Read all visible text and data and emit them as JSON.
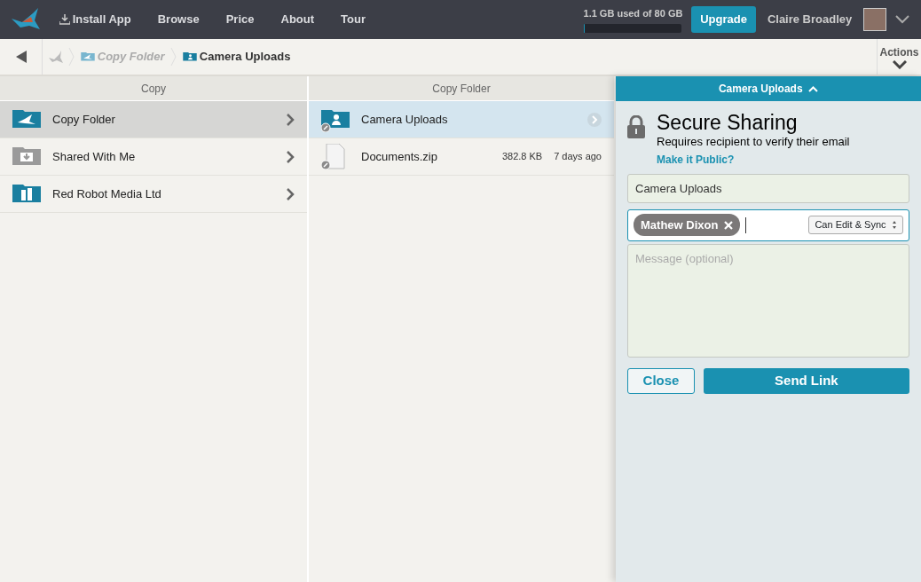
{
  "topbar": {
    "nav": [
      {
        "label": "Install App",
        "kind": "install"
      },
      {
        "label": "Browse",
        "kind": "plain"
      },
      {
        "label": "Price",
        "kind": "plain"
      },
      {
        "label": "About",
        "kind": "plain"
      },
      {
        "label": "Tour",
        "kind": "plain"
      }
    ],
    "storage": {
      "text": "1.1 GB used of 80 GB",
      "level": 0.014
    },
    "upgrade": "Upgrade",
    "user": "Claire Broadley"
  },
  "breadcrumb": {
    "items": [
      {
        "label": "Copy Folder",
        "kind": "crane",
        "selected": false
      },
      {
        "label": "Camera Uploads",
        "kind": "shared",
        "selected": true
      }
    ],
    "actions": "Actions"
  },
  "columns": [
    {
      "header": "Copy",
      "items": [
        {
          "name": "Copy Folder",
          "kind": "crane",
          "selected": true
        },
        {
          "name": "Shared With Me",
          "kind": "inbox",
          "selected": false
        },
        {
          "name": "Red Robot Media Ltd",
          "kind": "building",
          "selected": false
        }
      ]
    },
    {
      "header": "Copy Folder",
      "items": [
        {
          "name": "Camera Uploads",
          "kind": "shared",
          "selected": true,
          "linked": true
        },
        {
          "name": "Documents.zip",
          "kind": "zip",
          "selected": false,
          "linked": true,
          "size": "382.8 KB",
          "modified": "7 days ago"
        }
      ]
    }
  ],
  "share": {
    "title": "Camera Uploads",
    "heading": "Secure Sharing",
    "subtitle": "Requires recipient to verify their email",
    "public_link": "Make it Public?",
    "name_value": "Camera Uploads",
    "recipients": [
      {
        "name": "Mathew Dixon"
      }
    ],
    "permission": "Can Edit & Sync",
    "message_placeholder": "Message (optional)",
    "close": "Close",
    "send": "Send Link"
  }
}
